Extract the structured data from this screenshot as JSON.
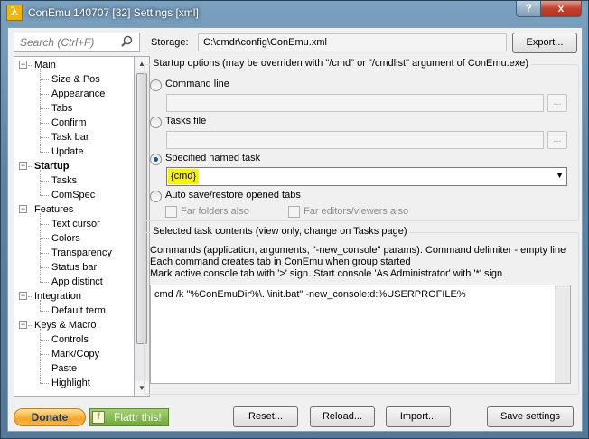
{
  "window": {
    "title": "ConEmu 140707 [32] Settings [xml]",
    "app_icon_glyph": "λ",
    "help_glyph": "?",
    "close_glyph": "x"
  },
  "search": {
    "placeholder": "Search (Ctrl+F)",
    "icon": "search-icon"
  },
  "tree": [
    {
      "label": "Main",
      "level": 0,
      "expander": "−"
    },
    {
      "label": "Size & Pos",
      "level": 1
    },
    {
      "label": "Appearance",
      "level": 1
    },
    {
      "label": "Tabs",
      "level": 1
    },
    {
      "label": "Confirm",
      "level": 1
    },
    {
      "label": "Task bar",
      "level": 1
    },
    {
      "label": "Update",
      "level": 1
    },
    {
      "label": "Startup",
      "level": 0,
      "expander": "−",
      "selected": true
    },
    {
      "label": "Tasks",
      "level": 1
    },
    {
      "label": "ComSpec",
      "level": 1
    },
    {
      "label": "Features",
      "level": 0,
      "expander": "−"
    },
    {
      "label": "Text cursor",
      "level": 1
    },
    {
      "label": "Colors",
      "level": 1
    },
    {
      "label": "Transparency",
      "level": 1
    },
    {
      "label": "Status bar",
      "level": 1
    },
    {
      "label": "App distinct",
      "level": 1
    },
    {
      "label": "Integration",
      "level": 0,
      "expander": "−"
    },
    {
      "label": "Default term",
      "level": 1
    },
    {
      "label": "Keys & Macro",
      "level": 0,
      "expander": "−"
    },
    {
      "label": "Controls",
      "level": 1
    },
    {
      "label": "Mark/Copy",
      "level": 1
    },
    {
      "label": "Paste",
      "level": 1
    },
    {
      "label": "Highlight",
      "level": 1
    }
  ],
  "storage": {
    "label": "Storage:",
    "path": "C:\\cmdr\\config\\ConEmu.xml",
    "export_label": "Export..."
  },
  "startup": {
    "group_title": "Startup options (may be overriden with \"/cmd\" or \"/cmdlist\" argument of ConEmu.exe)",
    "command_line_label": "Command line",
    "tasks_file_label": "Tasks file",
    "named_task_label": "Specified named task",
    "named_task_value": "{cmd}",
    "auto_save_label": "Auto save/restore opened tabs",
    "far_folders_label": "Far folders also",
    "far_editors_label": "Far editors/viewers also",
    "browse_glyph": "..."
  },
  "task_contents": {
    "group_title": "Selected task contents (view only, change on Tasks page)",
    "desc_line1": "Commands (application, arguments, \"-new_console\" params). Command delimiter - empty line",
    "desc_line2": "Each command creates tab in ConEmu when group started",
    "desc_line3": "Mark active console tab with '>' sign. Start console 'As Administrator' with '*' sign",
    "command": "cmd /k \"%ConEmuDir%\\..\\init.bat\"  -new_console:d:%USERPROFILE%"
  },
  "footer": {
    "donate_label": "Donate",
    "flattr_label": "Flattr this!",
    "reset_label": "Reset...",
    "reload_label": "Reload...",
    "import_label": "Import...",
    "save_label": "Save settings"
  }
}
